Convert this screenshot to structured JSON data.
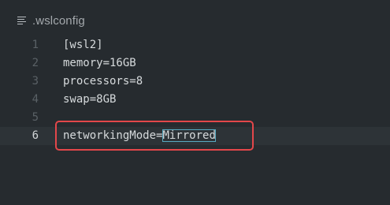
{
  "tab": {
    "title": ".wslconfig",
    "icon": "file-lines-icon"
  },
  "editor": {
    "lines": [
      {
        "number": "1",
        "text": "[wsl2]"
      },
      {
        "number": "2",
        "text": "memory=16GB"
      },
      {
        "number": "3",
        "text": "processors=8"
      },
      {
        "number": "4",
        "text": "swap=8GB"
      },
      {
        "number": "5",
        "text": ""
      },
      {
        "number": "6",
        "key": "networkingMode=",
        "value": "Mirrored"
      }
    ],
    "active_line": "6"
  },
  "colors": {
    "background": "#262b2f",
    "highlight_box": "#e3474a",
    "selection_outline": "#56a9c0"
  }
}
